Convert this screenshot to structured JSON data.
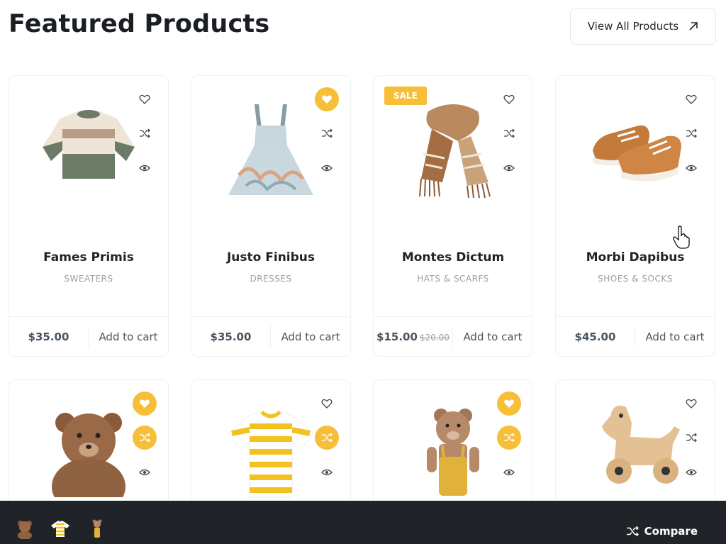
{
  "header": {
    "title": "Featured Products",
    "view_all_label": "View All Products"
  },
  "products_row1": [
    {
      "name": "Fames Primis",
      "category": "SWEATERS",
      "price": "$35.00",
      "old_price": "",
      "add_label": "Add to cart",
      "image": "sweater",
      "wishlisted": false,
      "compared": false
    },
    {
      "name": "Justo Finibus",
      "category": "DRESSES",
      "price": "$35.00",
      "old_price": "",
      "add_label": "Add to cart",
      "image": "dress",
      "wishlisted": true,
      "compared": false
    },
    {
      "name": "Montes Dictum",
      "category": "HATS & SCARFS",
      "price": "$15.00",
      "old_price": "$20.00",
      "add_label": "Add to cart",
      "image": "scarf",
      "badge": "SALE",
      "wishlisted": false,
      "compared": false
    },
    {
      "name": "Morbi Dapibus",
      "category": "SHOES & SOCKS",
      "price": "$45.00",
      "old_price": "",
      "add_label": "Add to cart",
      "image": "shoes",
      "wishlisted": false,
      "compared": false
    }
  ],
  "products_row2": [
    {
      "image": "teddy-bear",
      "wishlisted": true,
      "compared": true
    },
    {
      "image": "striped-tshirt",
      "wishlisted": false,
      "compared": true
    },
    {
      "image": "knit-bear-doll",
      "wishlisted": true,
      "compared": true
    },
    {
      "image": "wooden-horse",
      "wishlisted": false,
      "compared": false
    }
  ],
  "compare_bar": {
    "thumbs": [
      "teddy-bear",
      "striped-tshirt",
      "knit-bear-doll"
    ],
    "label": "Compare"
  },
  "colors": {
    "accent": "#f7be38",
    "bar": "#202428"
  }
}
